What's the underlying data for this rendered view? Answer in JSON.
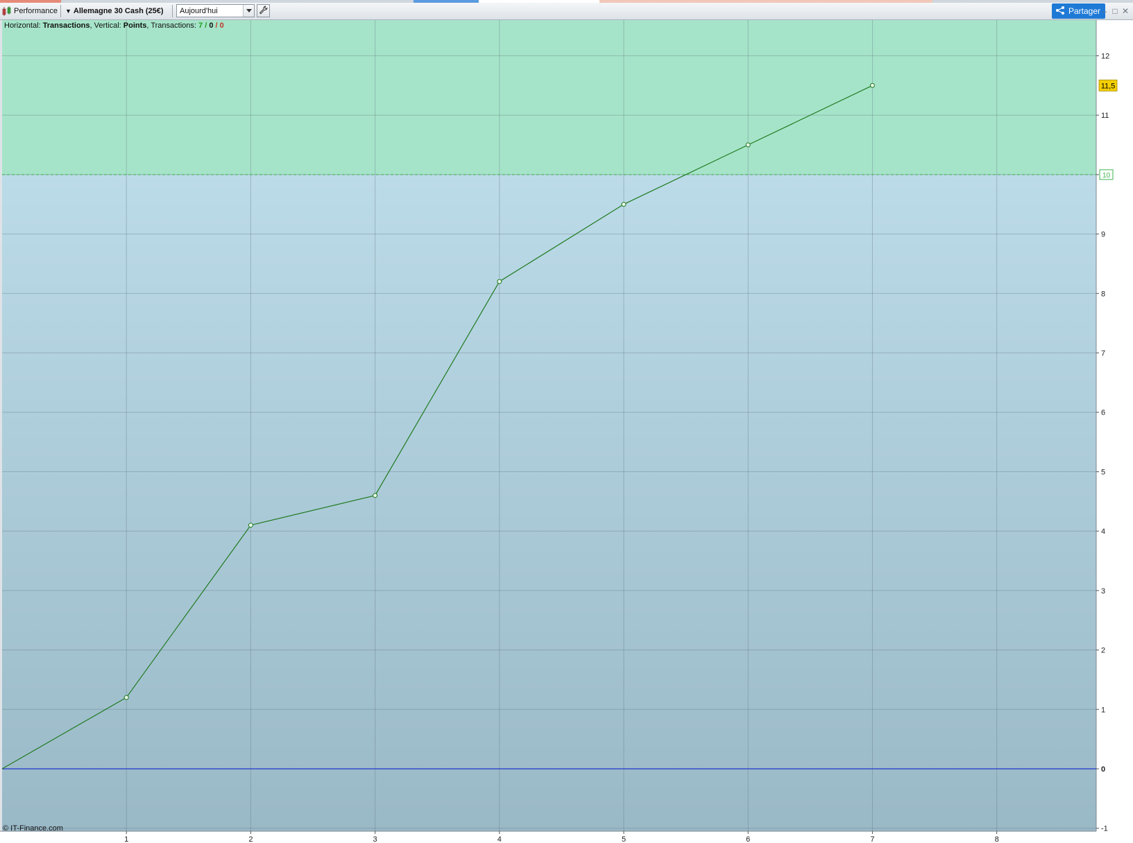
{
  "window": {
    "app_label": "Performance",
    "instrument": "Allemagne 30 Cash (25€)",
    "period_value": "Aujourd'hui",
    "share_label": "Partager"
  },
  "info": {
    "horizontal_label": "Horizontal: ",
    "horizontal_value": "Transactions",
    "vertical_label": ", Vertical: ",
    "vertical_value": "Points",
    "transactions_label": ", Transactions: ",
    "tx_winning": "7",
    "tx_sep1": " / ",
    "tx_neutral": "0",
    "tx_sep2": " / ",
    "tx_losing": "0"
  },
  "copyright": "© IT-Finance.com",
  "colors": {
    "profit_zone": "#a6e4c9",
    "chart_bg_top": "#c4e3f0",
    "chart_bg_bottom": "#9ab9c7",
    "line": "#1f7a1f",
    "zero_line": "#2233cc",
    "last_value_badge": "#f5d000",
    "target_line": "#3fb34f",
    "share_button": "#1f7ad6"
  },
  "chart_data": {
    "type": "line",
    "x": [
      0,
      1,
      2,
      3,
      4,
      5,
      6,
      7
    ],
    "y": [
      0,
      1.2,
      4.1,
      4.6,
      8.2,
      9.5,
      10.5,
      11.5
    ],
    "xlabel": "Transactions",
    "ylabel": "Points",
    "xlim": [
      0,
      8.8
    ],
    "ylim": [
      -1.05,
      12.6
    ],
    "x_ticks": [
      "1",
      "2",
      "3",
      "4",
      "5",
      "6",
      "7",
      "8"
    ],
    "y_ticks": [
      "-1",
      "0",
      "1",
      "2",
      "3",
      "4",
      "5",
      "6",
      "7",
      "8",
      "9",
      "10",
      "11",
      "12"
    ],
    "grid": true,
    "target_value": 10,
    "target_label": "10",
    "zero_label": "0",
    "last_value_label": "11,5"
  }
}
